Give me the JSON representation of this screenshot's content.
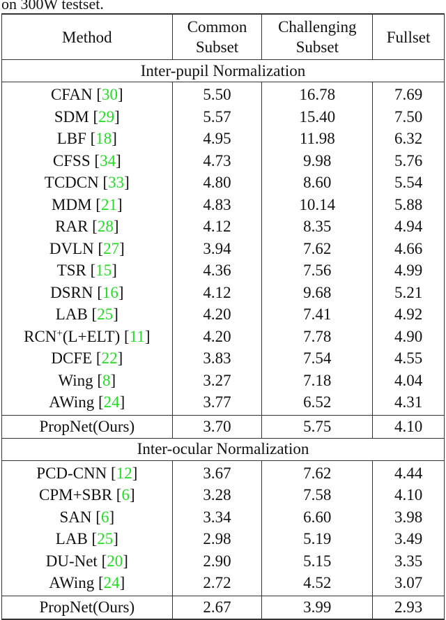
{
  "caption": "on 300W testset.",
  "colors": {
    "citation": "#22dd22",
    "rule": "#333333"
  },
  "table": {
    "headers": [
      {
        "lines": [
          "Method"
        ]
      },
      {
        "lines": [
          "Common",
          "Subset"
        ]
      },
      {
        "lines": [
          "Challenging",
          "Subset"
        ]
      },
      {
        "lines": [
          "Fullset"
        ]
      }
    ],
    "sections": [
      {
        "title": "Inter-pupil Normalization",
        "rows": [
          {
            "method": "CFAN",
            "cite": "30",
            "common": "5.50",
            "challenging": "16.78",
            "fullset": "7.69"
          },
          {
            "method": "SDM",
            "cite": "29",
            "common": "5.57",
            "challenging": "15.40",
            "fullset": "7.50"
          },
          {
            "method": "LBF",
            "cite": "18",
            "common": "4.95",
            "challenging": "11.98",
            "fullset": "6.32"
          },
          {
            "method": "CFSS",
            "cite": "34",
            "common": "4.73",
            "challenging": "9.98",
            "fullset": "5.76"
          },
          {
            "method": "TCDCN",
            "cite": "33",
            "common": "4.80",
            "challenging": "8.60",
            "fullset": "5.54"
          },
          {
            "method": "MDM",
            "cite": "21",
            "common": "4.83",
            "challenging": "10.14",
            "fullset": "5.88"
          },
          {
            "method": "RAR",
            "cite": "28",
            "common": "4.12",
            "challenging": "8.35",
            "fullset": "4.94"
          },
          {
            "method": "DVLN",
            "cite": "27",
            "common": "3.94",
            "challenging": "7.62",
            "fullset": "4.66"
          },
          {
            "method": "TSR",
            "cite": "15",
            "common": "4.36",
            "challenging": "7.56",
            "fullset": "4.99"
          },
          {
            "method": "DSRN",
            "cite": "16",
            "common": "4.12",
            "challenging": "9.68",
            "fullset": "5.21"
          },
          {
            "method": "LAB",
            "cite": "25",
            "common": "4.20",
            "challenging": "7.41",
            "fullset": "4.92"
          },
          {
            "method": "RCN",
            "method_sup": "+",
            "method_suffix": "(L+ELT)",
            "cite": "11",
            "common": "4.20",
            "challenging": "7.78",
            "fullset": "4.90"
          },
          {
            "method": "DCFE",
            "cite": "22",
            "common": "3.83",
            "challenging": "7.54",
            "fullset": "4.55"
          },
          {
            "method": "Wing",
            "cite": "8",
            "common": "3.27",
            "challenging": "7.18",
            "fullset": "4.04",
            "bold": [
              "common",
              "fullset"
            ]
          },
          {
            "method": "AWing",
            "cite": "24",
            "common": "3.77",
            "challenging": "6.52",
            "fullset": "4.31"
          }
        ],
        "ours": {
          "method": "PropNet(Ours)",
          "common": "3.70",
          "challenging": "5.75",
          "fullset": "4.10",
          "bold": [
            "method",
            "challenging"
          ]
        }
      },
      {
        "title": "Inter-ocular Normalization",
        "rows": [
          {
            "method": "PCD-CNN",
            "cite": "12",
            "common": "3.67",
            "challenging": "7.62",
            "fullset": "4.44"
          },
          {
            "method": "CPM+SBR",
            "cite": "6",
            "common": "3.28",
            "challenging": "7.58",
            "fullset": "4.10"
          },
          {
            "method": "SAN",
            "cite": "6",
            "common": "3.34",
            "challenging": "6.60",
            "fullset": "3.98"
          },
          {
            "method": "LAB",
            "cite": "25",
            "common": "2.98",
            "challenging": "5.19",
            "fullset": "3.49"
          },
          {
            "method": "DU-Net",
            "cite": "20",
            "common": "2.90",
            "challenging": "5.15",
            "fullset": "3.35"
          },
          {
            "method": "AWing",
            "cite": "24",
            "common": "2.72",
            "challenging": "4.52",
            "fullset": "3.07"
          }
        ],
        "ours": {
          "method": "PropNet(Ours)",
          "common": "2.67",
          "challenging": "3.99",
          "fullset": "2.93",
          "bold": [
            "method",
            "common",
            "challenging",
            "fullset"
          ]
        }
      }
    ]
  }
}
